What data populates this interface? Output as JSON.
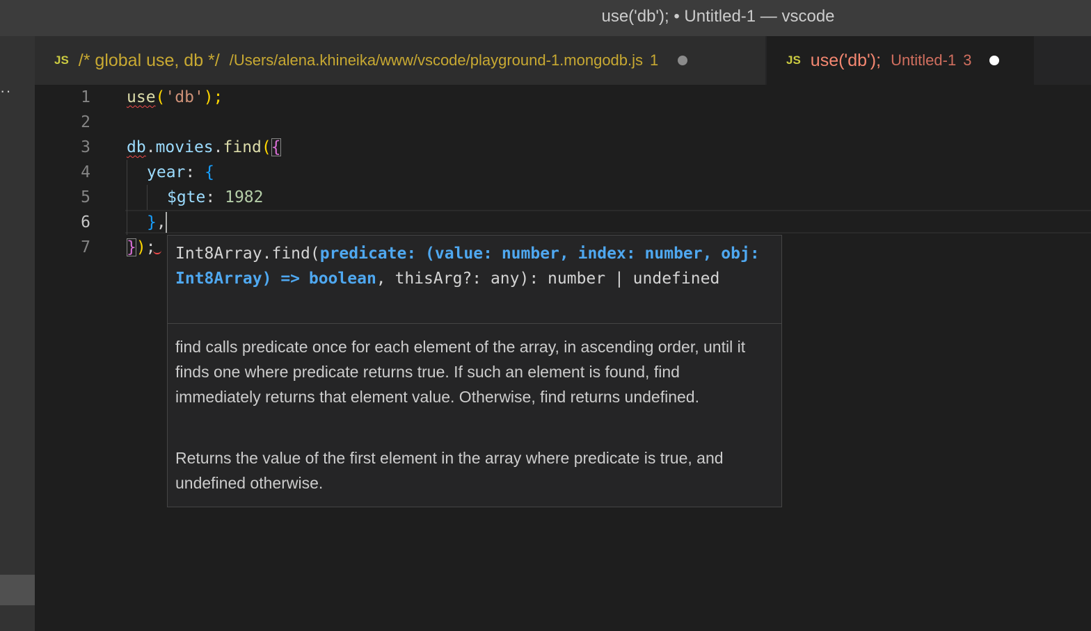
{
  "window": {
    "title": "use('db'); • Untitled-1 — vscode"
  },
  "activity_bar": {
    "more_label": "··"
  },
  "tabs": [
    {
      "name": "/* global use, db */",
      "description": "/Users/alena.khineika/www/vscode/playground-1.mongodb.js",
      "problems": "1",
      "icon": "js-icon",
      "icon_label": "JS",
      "active": false
    },
    {
      "name": "use('db');",
      "description": "Untitled-1",
      "problems": "3",
      "icon": "js-icon",
      "icon_label": "JS",
      "active": true
    }
  ],
  "editor": {
    "line_numbers": [
      "1",
      "2",
      "3",
      "4",
      "5",
      "6",
      "7"
    ],
    "current_line": "6",
    "code": {
      "l1_fn": "use",
      "l1_open": "(",
      "l1_str": "'db'",
      "l1_close": ");",
      "l3_db": "db",
      "l3_dot1": ".",
      "l3_movies": "movies",
      "l3_dot2": ".",
      "l3_find": "find",
      "l3_paren": "(",
      "l3_brace": "{",
      "l4_key": "year",
      "l4_colon": ": ",
      "l4_brace": "{",
      "l5_key": "$gte",
      "l5_colon": ": ",
      "l5_num": "1982",
      "l6_brace": "}",
      "l6_comma": ",",
      "l7_brace": "}",
      "l7_paren": ")",
      "l7_semi": ";"
    }
  },
  "hover": {
    "sig_prefix": "Int8Array.find(",
    "sig_param": "predicate: (value: number, index: number, obj: Int8Array) => boolean",
    "sig_suffix": ", thisArg?: any): number | undefined",
    "doc_p1": "find calls predicate once for each element of the array, in ascending order, until it finds one where predicate returns true. If such an element is found, find immediately returns that element value. Otherwise, find returns undefined.",
    "doc_p2": "Returns the value of the first element in the array where predicate is true, and undefined otherwise."
  },
  "colors": {
    "editor_bg": "#1e1e1e",
    "inactive_tab_text": "#c8a932",
    "active_tab_text": "#f48771",
    "param_highlight": "#4fa8f0"
  }
}
